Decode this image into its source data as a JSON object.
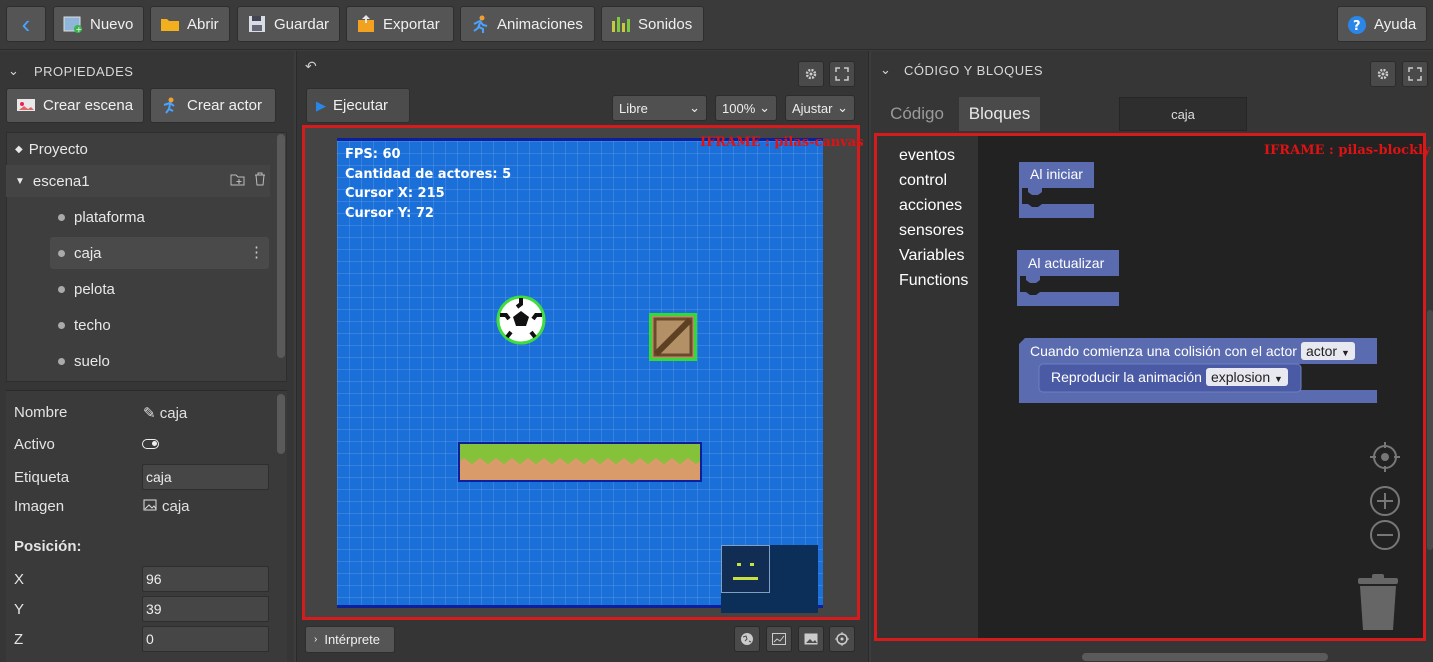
{
  "toolbar": {
    "back": "‹",
    "nuevo": "Nuevo",
    "abrir": "Abrir",
    "guardar": "Guardar",
    "exportar": "Exportar",
    "animaciones": "Animaciones",
    "sonidos": "Sonidos",
    "ayuda": "Ayuda"
  },
  "left": {
    "header": "PROPIEDADES",
    "crear_escena": "Crear escena",
    "crear_actor": "Crear actor",
    "tree": {
      "proyecto": "Proyecto",
      "escena": "escena1",
      "actors": [
        "plataforma",
        "caja",
        "pelota",
        "techo",
        "suelo"
      ],
      "selected": "caja"
    },
    "props": {
      "nombre_label": "Nombre",
      "nombre_value": "caja",
      "activo_label": "Activo",
      "etiqueta_label": "Etiqueta",
      "etiqueta_value": "caja",
      "imagen_label": "Imagen",
      "imagen_value": "caja",
      "posicion_label": "Posición:",
      "x_label": "X",
      "x_value": "96",
      "y_label": "Y",
      "y_value": "39",
      "z_label": "Z",
      "z_value": "0"
    }
  },
  "center": {
    "undo": "↶",
    "ejecutar": "Ejecutar",
    "mode_select": "Libre",
    "zoom_select": "100%",
    "fit_select": "Ajustar",
    "iframe_label": "IFRAME : pilas-canvas",
    "hud": {
      "fps": "FPS: 60",
      "actores": "Cantidad de actores: 5",
      "cursor_x": "Cursor X: 215",
      "cursor_y": "Cursor Y: 72"
    },
    "interprete": "Intérprete"
  },
  "right": {
    "header": "CÓDIGO Y BLOQUES",
    "tab_codigo": "Código",
    "tab_bloques": "Bloques",
    "actor_name": "caja",
    "iframe_label": "IFRAME : pilas-blockly",
    "toolbox": [
      "eventos",
      "control",
      "acciones",
      "sensores",
      "Variables",
      "Functions"
    ],
    "blocks": {
      "al_iniciar": "Al iniciar",
      "al_actualizar": "Al actualizar",
      "colision": "Cuando comienza una colisión con el actor",
      "colision_dropdown": "actor",
      "reproducir": "Reproducir la animación",
      "reproducir_dropdown": "explosion"
    }
  },
  "colors": {
    "accent": "#2a86e8",
    "iframe_border": "#d51b1b",
    "canvas_bg": "#1a6fd8",
    "block_purple": "#5b6bb0"
  }
}
